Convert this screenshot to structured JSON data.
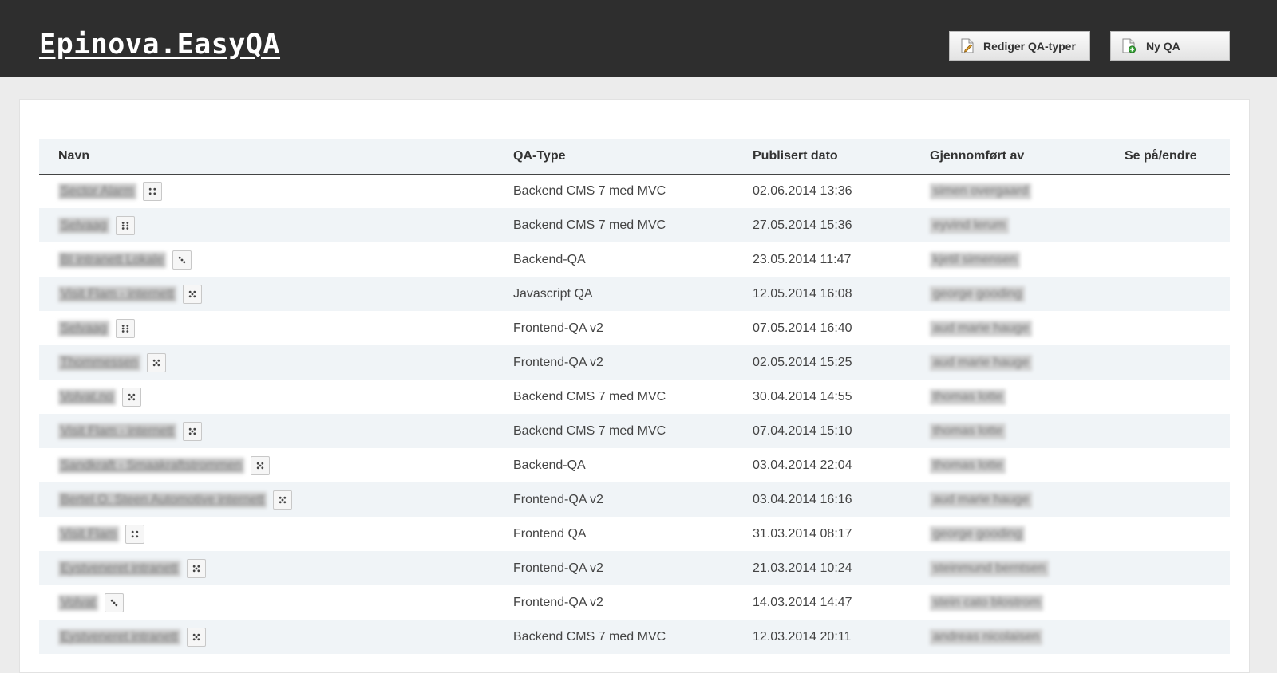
{
  "app": {
    "title": "Epinova.EasyQA"
  },
  "toolbar": {
    "edit_types_label": "Rediger QA-typer",
    "new_qa_label": "Ny QA"
  },
  "table": {
    "headers": {
      "name": "Navn",
      "type": "QA-Type",
      "date": "Publisert dato",
      "by": "Gjennomført av",
      "view": "Se på/endre"
    },
    "rows": [
      {
        "name": "Sector Alarm",
        "type": "Backend CMS 7 med MVC",
        "date": "02.06.2014 13:36",
        "by": "simen overgaard",
        "dice": [
          [
            0.3,
            0.3
          ],
          [
            0.7,
            0.3
          ],
          [
            0.3,
            0.7
          ],
          [
            0.7,
            0.7
          ]
        ]
      },
      {
        "name": "Selvaag",
        "type": "Backend CMS 7 med MVC",
        "date": "27.05.2014 15:36",
        "by": "eyvind lerum",
        "dice": [
          [
            0.3,
            0.25
          ],
          [
            0.7,
            0.25
          ],
          [
            0.3,
            0.5
          ],
          [
            0.7,
            0.5
          ],
          [
            0.3,
            0.75
          ],
          [
            0.7,
            0.75
          ]
        ]
      },
      {
        "name": "BI intranett Lokale",
        "type": "Backend-QA",
        "date": "23.05.2014 11:47",
        "by": "kjetil simensen",
        "dice": [
          [
            0.3,
            0.3
          ],
          [
            0.5,
            0.5
          ],
          [
            0.7,
            0.7
          ]
        ]
      },
      {
        "name": "Visit Flam - internett",
        "type": "Javascript QA",
        "date": "12.05.2014 16:08",
        "by": "george gooding",
        "dice": [
          [
            0.3,
            0.3
          ],
          [
            0.7,
            0.3
          ],
          [
            0.5,
            0.5
          ],
          [
            0.3,
            0.7
          ],
          [
            0.7,
            0.7
          ]
        ]
      },
      {
        "name": "Selvaag",
        "type": "Frontend-QA v2",
        "date": "07.05.2014 16:40",
        "by": "aud marie hauge",
        "dice": [
          [
            0.3,
            0.25
          ],
          [
            0.7,
            0.25
          ],
          [
            0.3,
            0.5
          ],
          [
            0.7,
            0.5
          ],
          [
            0.3,
            0.75
          ],
          [
            0.7,
            0.75
          ]
        ]
      },
      {
        "name": "Thommessen",
        "type": "Frontend-QA v2",
        "date": "02.05.2014 15:25",
        "by": "aud marie hauge",
        "dice": [
          [
            0.3,
            0.3
          ],
          [
            0.7,
            0.3
          ],
          [
            0.5,
            0.5
          ],
          [
            0.3,
            0.7
          ],
          [
            0.7,
            0.7
          ]
        ]
      },
      {
        "name": "Volvat.no",
        "type": "Backend CMS 7 med MVC",
        "date": "30.04.2014 14:55",
        "by": "thomas lotte",
        "dice": [
          [
            0.3,
            0.3
          ],
          [
            0.7,
            0.3
          ],
          [
            0.5,
            0.5
          ],
          [
            0.3,
            0.7
          ],
          [
            0.7,
            0.7
          ]
        ]
      },
      {
        "name": "Visit Flam - internett",
        "type": "Backend CMS 7 med MVC",
        "date": "07.04.2014 15:10",
        "by": "thomas lotte",
        "dice": [
          [
            0.3,
            0.3
          ],
          [
            0.7,
            0.3
          ],
          [
            0.5,
            0.5
          ],
          [
            0.3,
            0.7
          ],
          [
            0.7,
            0.7
          ]
        ]
      },
      {
        "name": "Sandkraft - Smaakraftstrommen",
        "type": "Backend-QA",
        "date": "03.04.2014 22:04",
        "by": "thomas lotte",
        "dice": [
          [
            0.3,
            0.3
          ],
          [
            0.7,
            0.3
          ],
          [
            0.5,
            0.5
          ],
          [
            0.3,
            0.7
          ],
          [
            0.7,
            0.7
          ]
        ]
      },
      {
        "name": "Bertel O. Steen Automotive internett",
        "type": "Frontend-QA v2",
        "date": "03.04.2014 16:16",
        "by": "aud marie hauge",
        "dice": [
          [
            0.3,
            0.3
          ],
          [
            0.7,
            0.3
          ],
          [
            0.5,
            0.5
          ],
          [
            0.3,
            0.7
          ],
          [
            0.7,
            0.7
          ]
        ]
      },
      {
        "name": "Visit Flam",
        "type": "Frontend QA",
        "date": "31.03.2014 08:17",
        "by": "george gooding",
        "dice": [
          [
            0.3,
            0.3
          ],
          [
            0.7,
            0.3
          ],
          [
            0.3,
            0.7
          ],
          [
            0.7,
            0.7
          ]
        ]
      },
      {
        "name": "Eystveneret intranett",
        "type": "Frontend-QA v2",
        "date": "21.03.2014 10:24",
        "by": "steinmund berntsen",
        "dice": [
          [
            0.3,
            0.3
          ],
          [
            0.7,
            0.3
          ],
          [
            0.5,
            0.5
          ],
          [
            0.3,
            0.7
          ],
          [
            0.7,
            0.7
          ]
        ]
      },
      {
        "name": "Volvat",
        "type": "Frontend-QA v2",
        "date": "14.03.2014 14:47",
        "by": "stein cato blostrom",
        "dice": [
          [
            0.3,
            0.3
          ],
          [
            0.5,
            0.5
          ],
          [
            0.7,
            0.7
          ]
        ]
      },
      {
        "name": "Eystveneret intranett",
        "type": "Backend CMS 7 med MVC",
        "date": "12.03.2014 20:11",
        "by": "andreas nicolaisen",
        "dice": [
          [
            0.3,
            0.3
          ],
          [
            0.7,
            0.3
          ],
          [
            0.5,
            0.5
          ],
          [
            0.3,
            0.7
          ],
          [
            0.7,
            0.7
          ]
        ]
      }
    ]
  }
}
